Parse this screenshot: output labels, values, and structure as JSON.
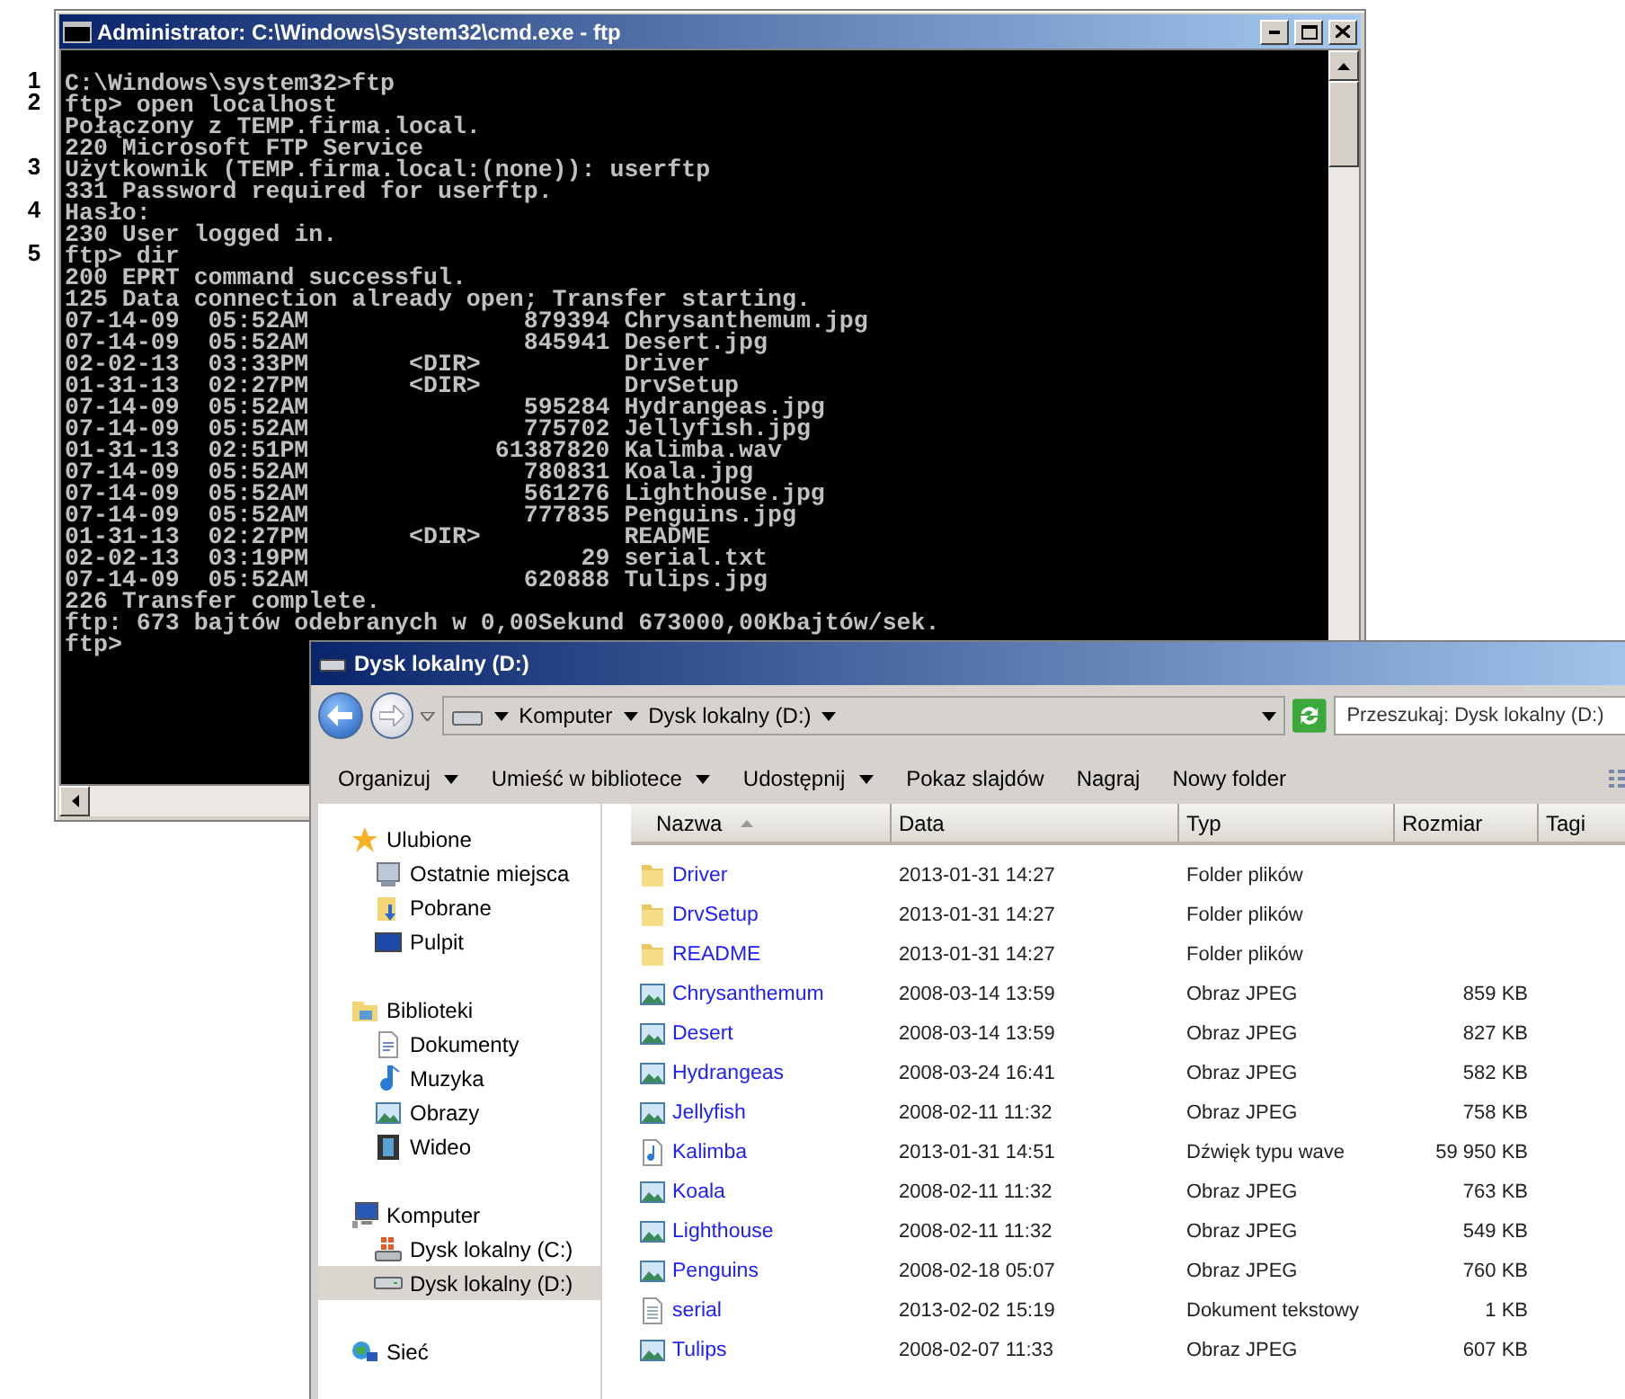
{
  "console_window": {
    "title": "Administrator: C:\\Windows\\System32\\cmd.exe - ftp",
    "lines": [
      {
        "text": "C:\\Windows\\system32>ftp",
        "marker": "1"
      },
      {
        "text": "ftp> open localhost",
        "marker": "2"
      },
      {
        "text": "Połączony z TEMP.firma.local."
      },
      {
        "text": "220 Microsoft FTP Service"
      },
      {
        "text": "Użytkownik (TEMP.firma.local:(none)): userftp",
        "marker": "3"
      },
      {
        "text": "331 Password required for userftp."
      },
      {
        "text": "Hasło:",
        "marker": "4"
      },
      {
        "text": "230 User logged in."
      },
      {
        "text": "ftp> dir",
        "marker": "5"
      },
      {
        "text": "200 EPRT command successful."
      },
      {
        "text": "125 Data connection already open; Transfer starting."
      },
      {
        "text": "07-14-09  05:52AM               879394 Chrysanthemum.jpg"
      },
      {
        "text": "07-14-09  05:52AM               845941 Desert.jpg"
      },
      {
        "text": "02-02-13  03:33PM       <DIR>          Driver"
      },
      {
        "text": "01-31-13  02:27PM       <DIR>          DrvSetup"
      },
      {
        "text": "07-14-09  05:52AM               595284 Hydrangeas.jpg"
      },
      {
        "text": "07-14-09  05:52AM               775702 Jellyfish.jpg"
      },
      {
        "text": "01-31-13  02:51PM             61387820 Kalimba.wav"
      },
      {
        "text": "07-14-09  05:52AM               780831 Koala.jpg"
      },
      {
        "text": "07-14-09  05:52AM               561276 Lighthouse.jpg"
      },
      {
        "text": "07-14-09  05:52AM               777835 Penguins.jpg"
      },
      {
        "text": "01-31-13  02:27PM       <DIR>          README"
      },
      {
        "text": "02-02-13  03:19PM                   29 serial.txt"
      },
      {
        "text": "07-14-09  05:52AM               620888 Tulips.jpg"
      },
      {
        "text": "226 Transfer complete."
      },
      {
        "text": "ftp: 673 bajtów odebranych w 0,00Sekund 673000,00Kbajtów/sek."
      },
      {
        "text": "ftp>"
      }
    ]
  },
  "explorer_window": {
    "title": "Dysk lokalny (D:)",
    "breadcrumb": [
      "Komputer",
      "Dysk lokalny (D:)"
    ],
    "search": {
      "placeholder": "Przeszukaj: Dysk lokalny (D:)"
    },
    "toolbar": [
      {
        "label": "Organizuj",
        "dropdown": true
      },
      {
        "label": "Umieść w bibliotece",
        "dropdown": true
      },
      {
        "label": "Udostępnij",
        "dropdown": true
      },
      {
        "label": "Pokaz slajdów",
        "dropdown": false
      },
      {
        "label": "Nagraj",
        "dropdown": false
      },
      {
        "label": "Nowy folder",
        "dropdown": false
      }
    ],
    "sidebar": [
      {
        "label": "Ulubione",
        "kind": "star",
        "selected": false,
        "children": [
          {
            "label": "Ostatnie miejsca",
            "kind": "recent",
            "selected": false
          },
          {
            "label": "Pobrane",
            "kind": "downloads",
            "selected": false
          },
          {
            "label": "Pulpit",
            "kind": "desktop",
            "selected": false
          }
        ]
      },
      {
        "label": "Biblioteki",
        "kind": "library",
        "selected": false,
        "children": [
          {
            "label": "Dokumenty",
            "kind": "document",
            "selected": false
          },
          {
            "label": "Muzyka",
            "kind": "music",
            "selected": false
          },
          {
            "label": "Obrazy",
            "kind": "image",
            "selected": false
          },
          {
            "label": "Wideo",
            "kind": "video",
            "selected": false
          }
        ]
      },
      {
        "label": "Komputer",
        "kind": "computer",
        "selected": false,
        "children": [
          {
            "label": "Dysk lokalny (C:)",
            "kind": "system-drive",
            "selected": false
          },
          {
            "label": "Dysk lokalny (D:)",
            "kind": "drive",
            "selected": true
          }
        ]
      },
      {
        "label": "Sieć",
        "kind": "network",
        "selected": false
      }
    ],
    "columns": [
      {
        "label": "Nazwa",
        "sorted": true
      },
      {
        "label": "Data",
        "sorted": false
      },
      {
        "label": "Typ",
        "sorted": false
      },
      {
        "label": "Rozmiar",
        "sorted": false
      },
      {
        "label": "Tagi",
        "sorted": false
      }
    ],
    "rows": [
      {
        "kind": "folder",
        "name": "Driver",
        "date": "2013-01-31 14:27",
        "type": "Folder plików"
      },
      {
        "kind": "folder",
        "name": "DrvSetup",
        "date": "2013-01-31 14:27",
        "type": "Folder plików"
      },
      {
        "kind": "folder",
        "name": "README",
        "date": "2013-01-31 14:27",
        "type": "Folder plików"
      },
      {
        "kind": "image",
        "name": "Chrysanthemum",
        "date": "2008-03-14 13:59",
        "type": "Obraz JPEG",
        "size": "859 KB"
      },
      {
        "kind": "image",
        "name": "Desert",
        "date": "2008-03-14 13:59",
        "type": "Obraz JPEG",
        "size": "827 KB"
      },
      {
        "kind": "image",
        "name": "Hydrangeas",
        "date": "2008-03-24 16:41",
        "type": "Obraz JPEG",
        "size": "582 KB"
      },
      {
        "kind": "image",
        "name": "Jellyfish",
        "date": "2008-02-11 11:32",
        "type": "Obraz JPEG",
        "size": "758 KB"
      },
      {
        "kind": "audio",
        "name": "Kalimba",
        "date": "2013-01-31 14:51",
        "type": "Dźwięk typu wave",
        "size": "59 950 KB"
      },
      {
        "kind": "image",
        "name": "Koala",
        "date": "2008-02-11 11:32",
        "type": "Obraz JPEG",
        "size": "763 KB"
      },
      {
        "kind": "image",
        "name": "Lighthouse",
        "date": "2008-02-11 11:32",
        "type": "Obraz JPEG",
        "size": "549 KB"
      },
      {
        "kind": "image",
        "name": "Penguins",
        "date": "2008-02-18 05:07",
        "type": "Obraz JPEG",
        "size": "760 KB"
      },
      {
        "kind": "text",
        "name": "serial",
        "date": "2013-02-02 15:19",
        "type": "Dokument tekstowy",
        "size": "1 KB"
      },
      {
        "kind": "image",
        "name": "Tulips",
        "date": "2008-02-07 11:33",
        "type": "Obraz JPEG",
        "size": "607 KB"
      }
    ]
  }
}
